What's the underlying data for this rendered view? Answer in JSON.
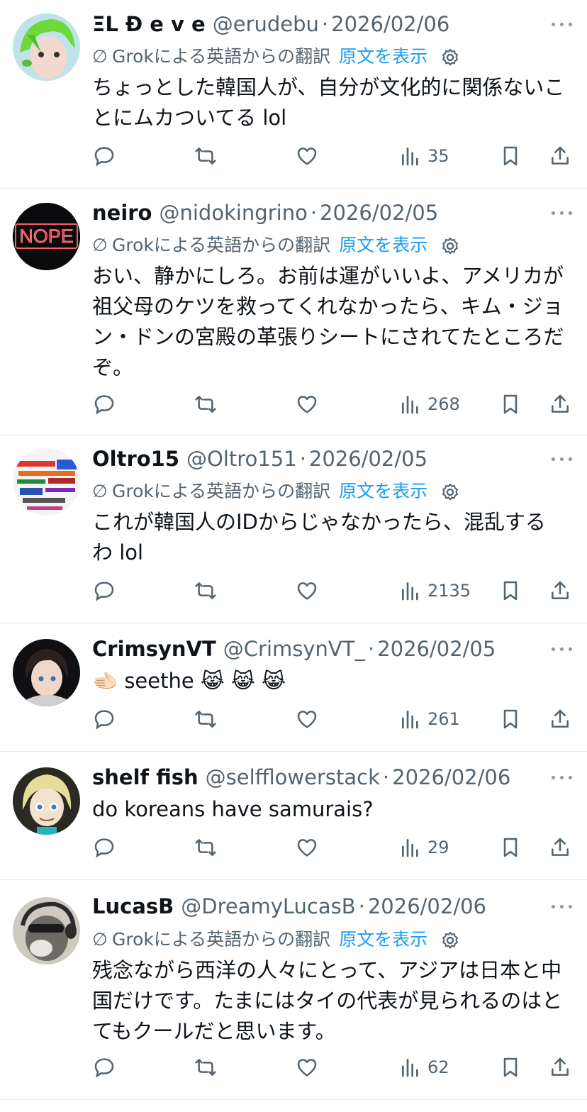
{
  "grok_label": "Grokによる英語からの翻訳",
  "show_original": "原文を表示",
  "posts": [
    {
      "name": "ΞL Đ e v e",
      "handle": "@erudebu",
      "sep": "·",
      "date": "2026/02/06",
      "translated": true,
      "body": "ちょっとした韓国人が、自分が文化的に関係ないことにムカついてる lol",
      "views": "35",
      "avatar_icon": "green-haired-anime-avatar"
    },
    {
      "name": "neiro",
      "handle": "@nidokingrino",
      "sep": "·",
      "date": "2026/02/05",
      "translated": true,
      "body": "おい、静かにしろ。お前は運がいいよ、アメリカが祖父母のケツを救ってくれなかったら、キム・ジョン・ドンの宮殿の革張りシートにされてたところだぞ。",
      "views": "268",
      "avatar_text": "NOPE"
    },
    {
      "name": "Oltro15",
      "handle": "@Oltro151",
      "sep": "·",
      "date": "2026/02/05",
      "translated": true,
      "body": "これが韓国人のIDからじゃなかったら、混乱するわ lol",
      "views": "2135",
      "avatar_icon": "text-collage-avatar"
    },
    {
      "name": "CrimsynVT",
      "handle": "@CrimsynVT_",
      "sep": "·",
      "date": "2026/02/05",
      "translated": false,
      "body": "🫲🏻 seethe 😹 😹 😹",
      "views": "261",
      "avatar_icon": "dark-haired-anime-avatar"
    },
    {
      "name": "shelf fish",
      "handle": "@selfflowerstack",
      "sep": "·",
      "date": "2026/02/06",
      "translated": false,
      "body": "do koreans have samurais?",
      "views": "29",
      "avatar_icon": "blonde-anime-avatar"
    },
    {
      "name": "LucasB",
      "handle": "@DreamyLucasB",
      "sep": "·",
      "date": "2026/02/06",
      "translated": true,
      "body": "残念ながら西洋の人々にとって、アジアは日本と中国だけです。たまにはタイの代表が見られるのはとてもクールだと思います。",
      "views": "62",
      "avatar_icon": "dog-with-headphones-avatar"
    }
  ],
  "icons": {
    "reply": "reply-icon",
    "repost": "repost-icon",
    "like": "like-icon",
    "views": "views-icon",
    "bookmark": "bookmark-icon",
    "share": "share-icon",
    "more": "more-icon",
    "gear": "gear-icon"
  },
  "colors": {
    "link": "#1d9bf0",
    "muted": "#536471",
    "text": "#0f1419",
    "divider": "#e6e9ec"
  }
}
